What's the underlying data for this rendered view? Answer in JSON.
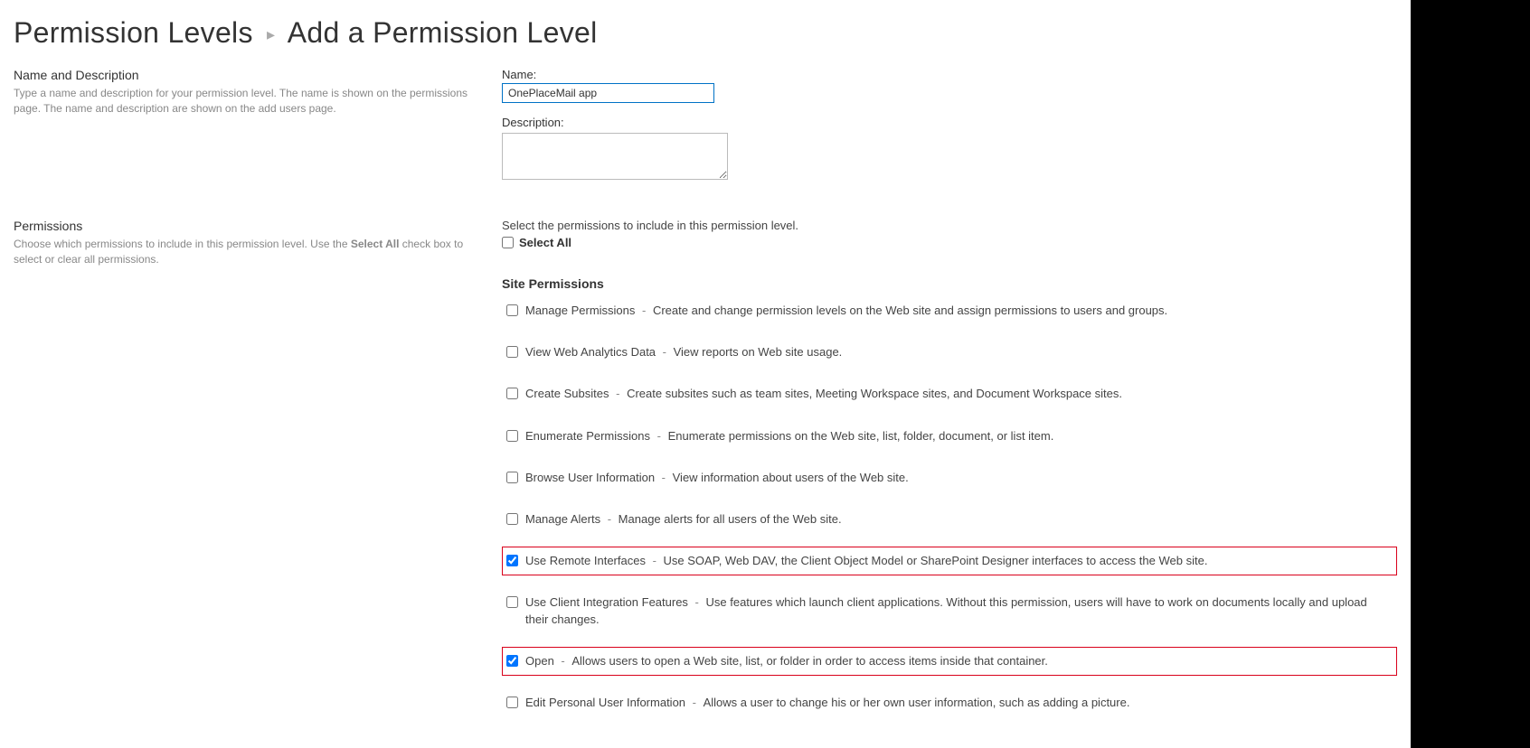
{
  "breadcrumb": {
    "parent": "Permission Levels",
    "current": "Add a Permission Level"
  },
  "nameSection": {
    "title": "Name and Description",
    "desc": "Type a name and description for your permission level.  The name is shown on the permissions page.  The name and description are shown on the add users page.",
    "nameLabel": "Name:",
    "nameValue": "OnePlaceMail app",
    "descLabel": "Description:",
    "descValue": ""
  },
  "permSection": {
    "title": "Permissions",
    "descPrefix": "Choose which permissions to include in this permission level.  Use the ",
    "descBold": "Select All",
    "descSuffix": " check box to select or clear all permissions.",
    "intro": "Select the permissions to include in this permission level.",
    "selectAllLabel": "Select All",
    "selectAllChecked": false,
    "groupHeading": "Site Permissions",
    "items": [
      {
        "name": "Manage Permissions",
        "desc": "Create and change permission levels on the Web site and assign permissions to users and groups.",
        "checked": false,
        "highlight": false
      },
      {
        "name": "View Web Analytics Data",
        "desc": "View reports on Web site usage.",
        "checked": false,
        "highlight": false
      },
      {
        "name": "Create Subsites",
        "desc": "Create subsites such as team sites, Meeting Workspace sites, and Document Workspace sites.",
        "checked": false,
        "highlight": false
      },
      {
        "name": "Enumerate Permissions",
        "desc": "Enumerate permissions on the Web site, list, folder, document, or list item.",
        "checked": false,
        "highlight": false
      },
      {
        "name": "Browse User Information",
        "desc": "View information about users of the Web site.",
        "checked": false,
        "highlight": false
      },
      {
        "name": "Manage Alerts",
        "desc": "Manage alerts for all users of the Web site.",
        "checked": false,
        "highlight": false
      },
      {
        "name": "Use Remote Interfaces",
        "desc": "Use SOAP, Web DAV, the Client Object Model or SharePoint Designer interfaces to access the Web site.",
        "checked": true,
        "highlight": true
      },
      {
        "name": "Use Client Integration Features",
        "desc": "Use features which launch client applications. Without this permission, users will have to work on documents locally and upload their changes.",
        "checked": false,
        "highlight": false
      },
      {
        "name": "Open",
        "desc": "Allows users to open a Web site, list, or folder in order to access items inside that container.",
        "checked": true,
        "highlight": true
      },
      {
        "name": "Edit Personal User Information",
        "desc": "Allows a user to change his or her own user information, such as adding a picture.",
        "checked": false,
        "highlight": false
      }
    ]
  }
}
